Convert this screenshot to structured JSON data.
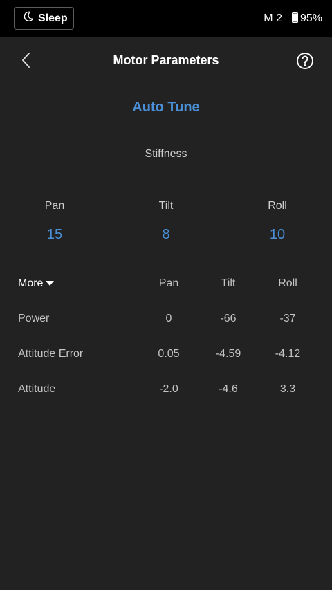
{
  "status_bar": {
    "sleep_label": "Sleep",
    "mode_label": "M 2",
    "battery_percent": "95%"
  },
  "header": {
    "title": "Motor Parameters"
  },
  "auto_tune_label": "Auto Tune",
  "stiffness": {
    "label": "Stiffness",
    "axes": [
      {
        "name": "Pan",
        "value": "15"
      },
      {
        "name": "Tilt",
        "value": "8"
      },
      {
        "name": "Roll",
        "value": "10"
      }
    ]
  },
  "table": {
    "more_label": "More",
    "columns": [
      "Pan",
      "Tilt",
      "Roll"
    ],
    "rows": [
      {
        "label": "Power",
        "values": [
          "0",
          "-66",
          "-37"
        ]
      },
      {
        "label": "Attitude Error",
        "values": [
          "0.05",
          "-4.59",
          "-4.12"
        ]
      },
      {
        "label": "Attitude",
        "values": [
          "-2.0",
          "-4.6",
          "3.3"
        ]
      }
    ]
  },
  "icons": {
    "moon": "moon-icon",
    "battery": "battery-icon",
    "back": "chevron-left-icon",
    "help": "question-circle-icon",
    "dropdown": "caret-down-icon"
  },
  "colors": {
    "accent": "#4a90d9",
    "background": "#222222",
    "statusbar": "#000000"
  }
}
